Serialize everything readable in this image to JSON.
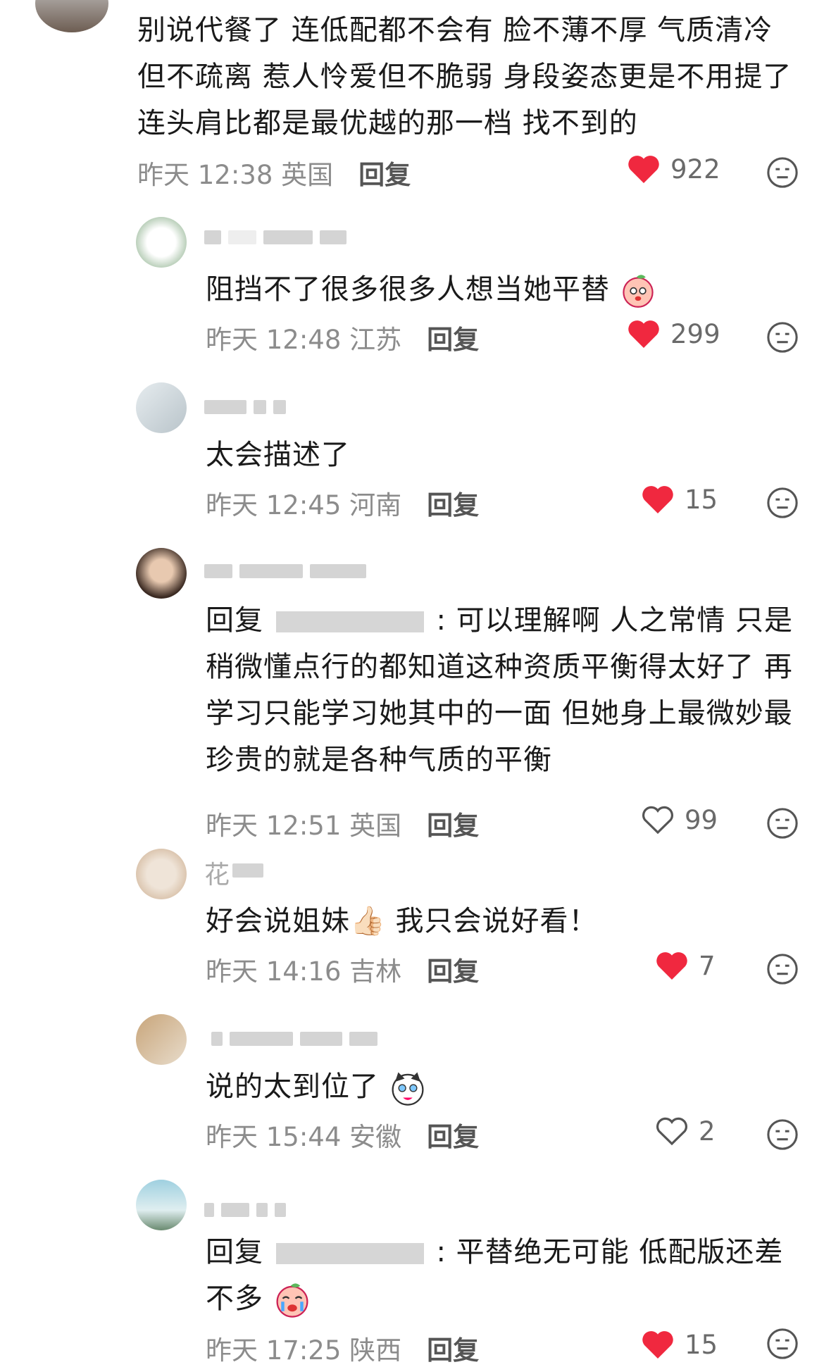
{
  "comments": [
    {
      "text": "别说代餐了 连低配都不会有 脸不薄不厚 气质清冷但不疏离 惹人怜爱但不脆弱 身段姿态更是不用提了 连头肩比都是最优越的那一档 找不到的",
      "time": "昨天 12:38",
      "location": "英国",
      "reply_label": "回复",
      "likes": "922",
      "liked": true
    },
    {
      "text": "阻挡不了很多很多人想当她平替",
      "time": "昨天 12:48",
      "location": "江苏",
      "reply_label": "回复",
      "likes": "299",
      "liked": true
    },
    {
      "text": "太会描述了",
      "time": "昨天 12:45",
      "location": "河南",
      "reply_label": "回复",
      "likes": "15",
      "liked": true
    },
    {
      "reply_prefix": "回复",
      "text": ": 可以理解啊 人之常情 只是稍微懂点行的都知道这种资质平衡得太好了 再学习只能学习她其中的一面 但她身上最微妙最珍贵的就是各种气质的平衡",
      "time": "昨天 12:51",
      "location": "英国",
      "reply_label": "回复",
      "likes": "99",
      "liked": false
    },
    {
      "name_partial": "花",
      "text": "好会说姐妹👍🏻 我只会说好看！",
      "time": "昨天 14:16",
      "location": "吉林",
      "reply_label": "回复",
      "likes": "7",
      "liked": true
    },
    {
      "text": "说的太到位了",
      "time": "昨天 15:44",
      "location": "安徽",
      "reply_label": "回复",
      "likes": "2",
      "liked": false
    },
    {
      "reply_prefix": "回复",
      "text": ": 平替绝无可能 低配版还差不多",
      "time": "昨天 17:25",
      "location": "陕西",
      "reply_label": "回复",
      "likes": "15",
      "liked": true
    }
  ],
  "colors": {
    "heart_red": "#f0283f",
    "meta_gray": "#8c8c8c"
  }
}
